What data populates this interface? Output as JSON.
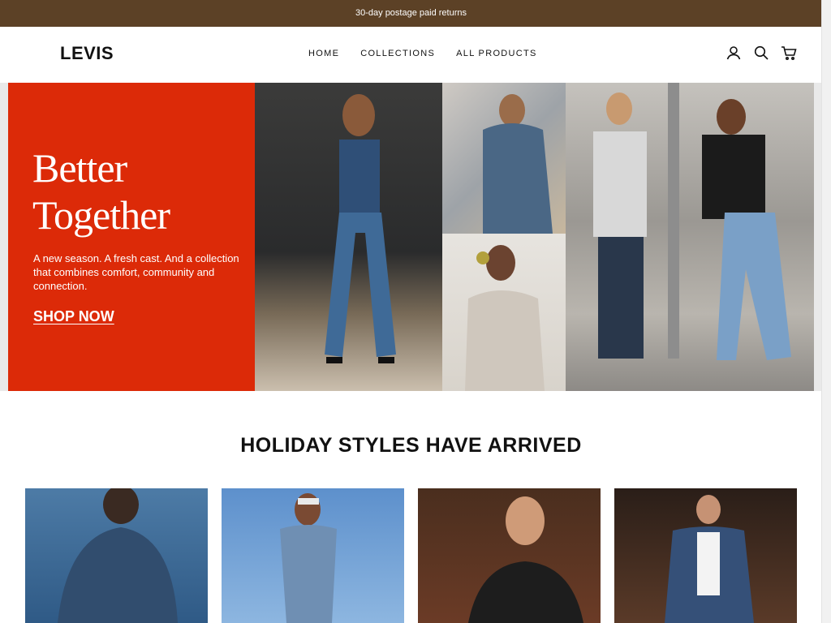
{
  "announcement": {
    "text": "30-day postage paid returns"
  },
  "header": {
    "logo": "LEVIS",
    "nav": [
      {
        "label": "HOME"
      },
      {
        "label": "COLLECTIONS"
      },
      {
        "label": "ALL PRODUCTS"
      }
    ],
    "icons": [
      "account-icon",
      "search-icon",
      "cart-icon"
    ]
  },
  "hero": {
    "title_line1": "Better",
    "title_line2": "Together",
    "body": "A new season. A fresh cast. And a collection that combines comfort, community and connection.",
    "cta": "SHOP NOW",
    "accent_color": "#dc2a08"
  },
  "section": {
    "title": "HOLIDAY STYLES HAVE ARRIVED"
  },
  "colors": {
    "announcement_bg": "#5c4126",
    "hero_red": "#dc2a08"
  }
}
